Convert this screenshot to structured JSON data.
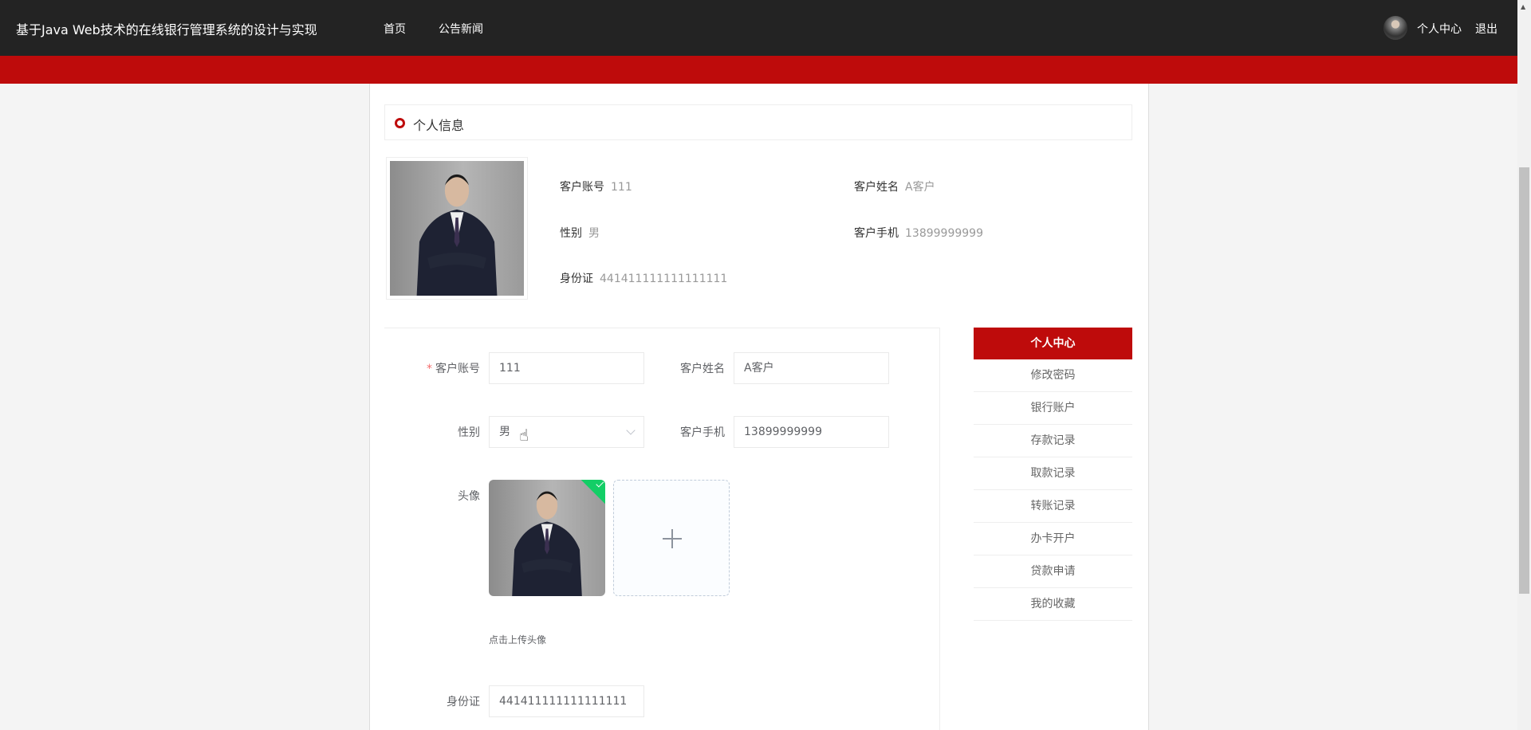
{
  "header": {
    "title": "基于Java Web技术的在线银行管理系统的设计与实现",
    "nav": [
      "首页",
      "公告新闻"
    ],
    "user_center": "个人中心",
    "logout": "退出"
  },
  "section": {
    "title": "个人信息"
  },
  "info": {
    "account_label": "客户账号",
    "account": "111",
    "name_label": "客户姓名",
    "name": "A客户",
    "gender_label": "性别",
    "gender": "男",
    "phone_label": "客户手机",
    "phone": "13899999999",
    "id_label": "身份证",
    "id": "441411111111111111"
  },
  "form": {
    "account_label": "客户账号",
    "account": "111",
    "name_label": "客户姓名",
    "name": "A客户",
    "gender_label": "性别",
    "gender": "男",
    "phone_label": "客户手机",
    "phone": "13899999999",
    "avatar_label": "头像",
    "avatar_hint": "点击上传头像",
    "id_label": "身份证",
    "id": "441411111111111111",
    "required_mark": "*"
  },
  "sidebar": {
    "items": [
      "个人中心",
      "修改密码",
      "银行账户",
      "存款记录",
      "取款记录",
      "转账记录",
      "办卡开户",
      "贷款申请",
      "我的收藏"
    ],
    "active": 0
  },
  "colors": {
    "brand": "#be0b0b",
    "header": "#232323",
    "success": "#13ce66"
  }
}
